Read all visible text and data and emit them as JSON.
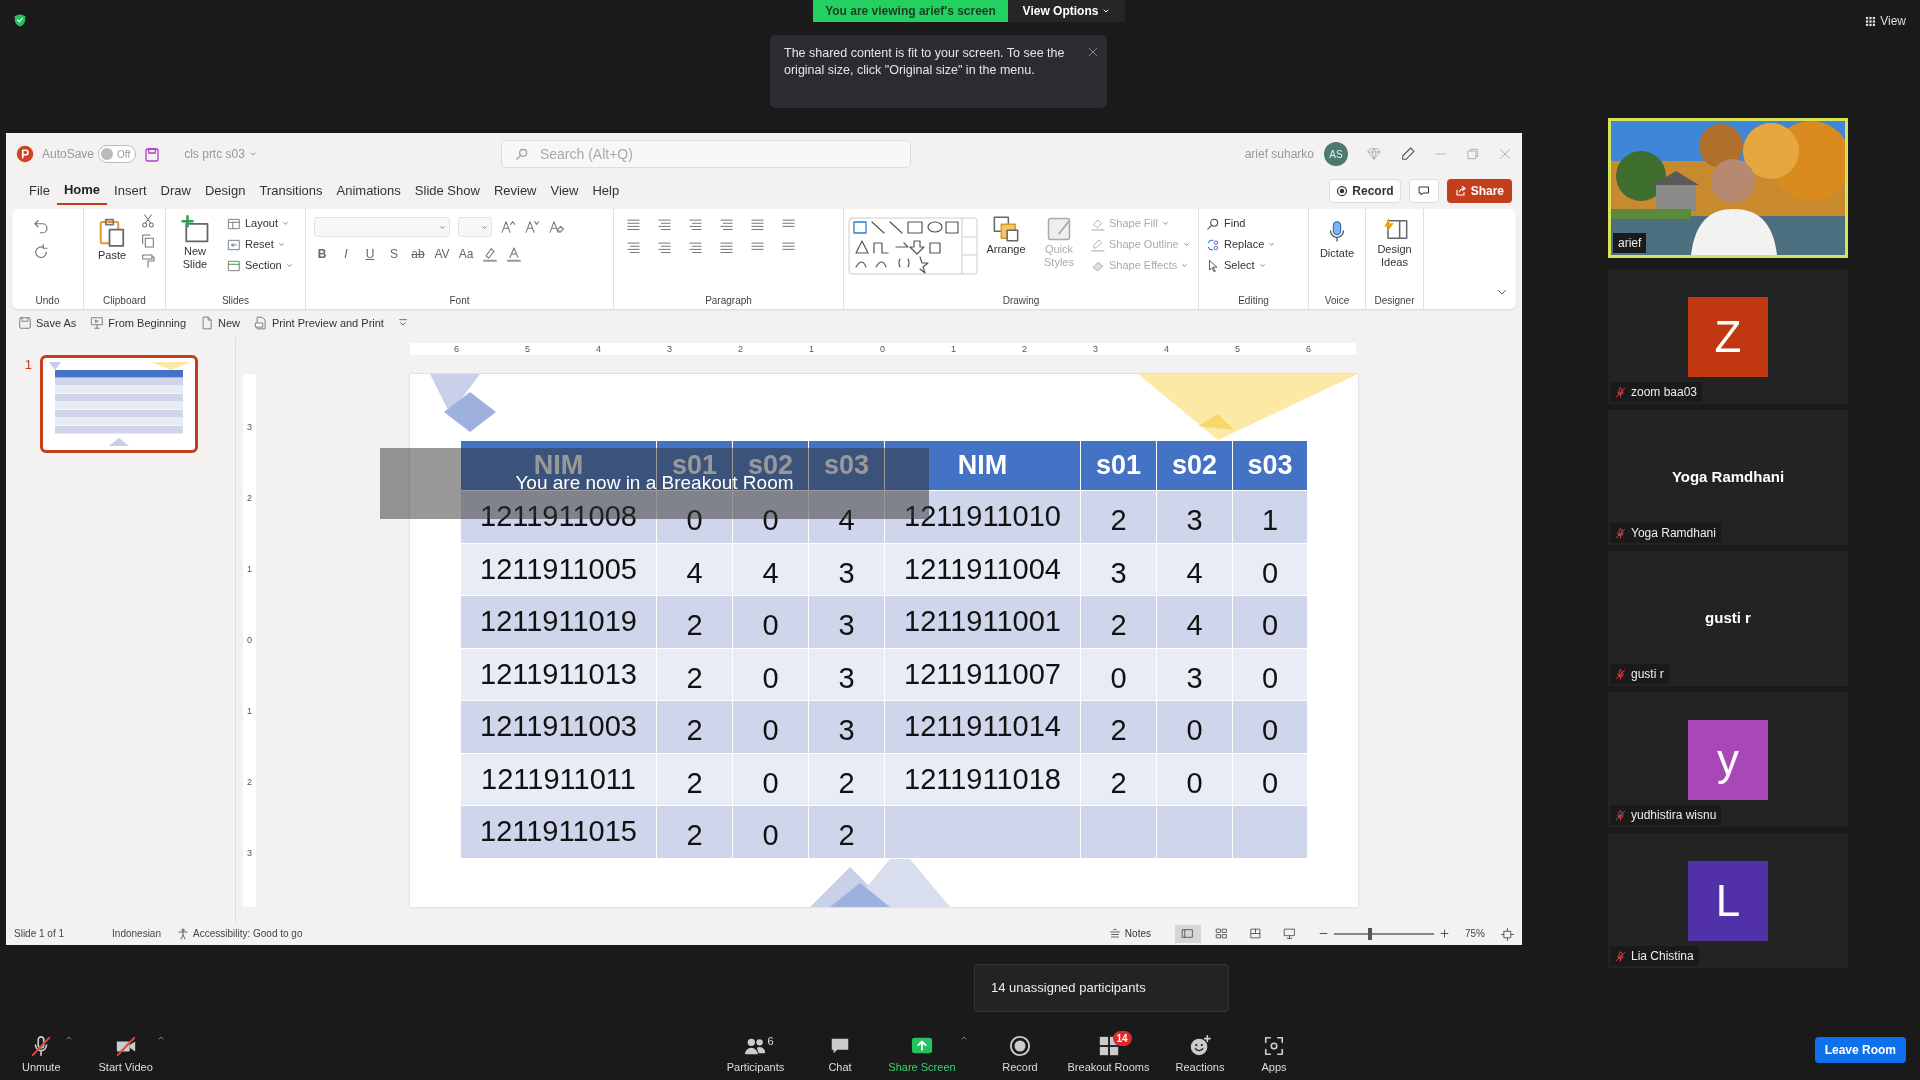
{
  "zoom_top": {
    "share_banner": "You are viewing arief's screen",
    "view_options": "View Options",
    "notice": "The shared content is fit to your screen. To see the original size, click \"Original size\" in the menu.",
    "view": "View"
  },
  "powerpoint": {
    "autosave": {
      "label": "AutoSave",
      "on": false,
      "state_text": "Off"
    },
    "file_name": "cls prtc s03",
    "search": {
      "placeholder": "Search (Alt+Q)"
    },
    "user": {
      "name": "arief suharko",
      "initials": "AS"
    },
    "menu_tabs": [
      {
        "label": "File",
        "selected": false
      },
      {
        "label": "Home",
        "selected": true
      },
      {
        "label": "Insert",
        "selected": false
      },
      {
        "label": "Draw",
        "selected": false
      },
      {
        "label": "Design",
        "selected": false
      },
      {
        "label": "Transitions",
        "selected": false
      },
      {
        "label": "Animations",
        "selected": false
      },
      {
        "label": "Slide Show",
        "selected": false
      },
      {
        "label": "Review",
        "selected": false
      },
      {
        "label": "View",
        "selected": false
      },
      {
        "label": "Help",
        "selected": false
      }
    ],
    "record": "Record",
    "share": "Share",
    "ribbon_groups": [
      {
        "kind": "undo",
        "label": "Undo"
      },
      {
        "kind": "clipboard",
        "label": "Clipboard",
        "items": [
          {
            "label": "Paste"
          }
        ]
      },
      {
        "kind": "slides",
        "label": "Slides",
        "items": [
          {
            "label": "New Slide"
          },
          {
            "label": "Layout"
          },
          {
            "label": "Reset"
          },
          {
            "label": "Section"
          }
        ]
      },
      {
        "kind": "font",
        "label": "Font",
        "glyphs": [
          "B",
          "I",
          "U",
          "S",
          "ab",
          "AV",
          "Aa"
        ]
      },
      {
        "kind": "paragraph",
        "label": "Paragraph"
      },
      {
        "kind": "drawing",
        "label": "Drawing",
        "items": [
          {
            "label": "Arrange",
            "disabled": false
          },
          {
            "label": "Quick Styles",
            "disabled": true
          },
          {
            "label": "Shape Fill",
            "disabled": true
          },
          {
            "label": "Shape Outline",
            "disabled": true
          },
          {
            "label": "Shape Effects",
            "disabled": true
          }
        ]
      },
      {
        "kind": "editing",
        "label": "Editing",
        "items": [
          {
            "label": "Find"
          },
          {
            "label": "Replace"
          },
          {
            "label": "Select"
          }
        ]
      },
      {
        "kind": "voice",
        "label": "Voice",
        "items": [
          {
            "label": "Dictate"
          }
        ]
      },
      {
        "kind": "designer",
        "label": "Designer",
        "items": [
          {
            "label": "Design Ideas"
          }
        ]
      }
    ],
    "quick_access": [
      {
        "kind": "save",
        "label": "Save As"
      },
      {
        "kind": "present",
        "label": "From Beginning"
      },
      {
        "kind": "new",
        "label": "New"
      },
      {
        "kind": "print",
        "label": "Print Preview and Print"
      }
    ],
    "slides_panel": [
      {
        "number": "1",
        "selected": true
      }
    ],
    "ruler": {
      "horizontal": [
        "6",
        "5",
        "4",
        "3",
        "2",
        "1",
        "0",
        "1",
        "2",
        "3",
        "4",
        "5",
        "6"
      ],
      "vertical": [
        "3",
        "2",
        "1",
        "0",
        "1",
        "2",
        "3"
      ]
    },
    "table": {
      "columns": [
        "NIM",
        "s01",
        "s02",
        "s03",
        "NIM",
        "s01",
        "s02",
        "s03"
      ],
      "rows": [
        [
          "1211911008",
          "0",
          "0",
          "4",
          "1211911010",
          "2",
          "3",
          "1"
        ],
        [
          "1211911005",
          "4",
          "4",
          "3",
          "1211911004",
          "3",
          "4",
          "0"
        ],
        [
          "1211911019",
          "2",
          "0",
          "3",
          "1211911001",
          "2",
          "4",
          "0"
        ],
        [
          "1211911013",
          "2",
          "0",
          "3",
          "1211911007",
          "0",
          "3",
          "0"
        ],
        [
          "1211911003",
          "2",
          "0",
          "3",
          "1211911014",
          "2",
          "0",
          "0"
        ],
        [
          "1211911011",
          "2",
          "0",
          "2",
          "1211911018",
          "2",
          "0",
          "0"
        ],
        [
          "1211911015",
          "2",
          "0",
          "2"
        ]
      ]
    },
    "status_bar": {
      "slide_info": "Slide 1 of 1",
      "language": "Indonesian",
      "accessibility": "Accessibility: Good to go",
      "notes": "Notes",
      "views": [
        {
          "selected": true
        },
        {
          "selected": false
        },
        {
          "selected": false
        },
        {
          "selected": false
        }
      ],
      "zoom": {
        "level": 0.36
      },
      "zoom_value": "75%"
    }
  },
  "breakout_toast": "You are now in a Breakout Room",
  "gallery": [
    {
      "kind": "video",
      "name": "arief",
      "speaking": true,
      "muted": false
    },
    {
      "kind": "avatar",
      "initial": "Z",
      "color": "#c1370f",
      "name": "zoom baa03",
      "speaking": false,
      "muted": true
    },
    {
      "kind": "name",
      "display": "Yoga Ramdhani",
      "name": "Yoga Ramdhani",
      "speaking": false,
      "muted": true
    },
    {
      "kind": "name",
      "display": "gusti r",
      "name": "gusti r",
      "speaking": false,
      "muted": true
    },
    {
      "kind": "avatar",
      "initial": "y",
      "color": "#a847b8",
      "name": "yudhistira wisnu",
      "speaking": false,
      "muted": true
    },
    {
      "kind": "avatar",
      "initial": "L",
      "color": "#5230a8",
      "name": "Lia Chistina",
      "speaking": false,
      "muted": true
    }
  ],
  "toolbar": {
    "audio": {
      "label": "Unmute",
      "muted": true
    },
    "video": {
      "label": "Start Video",
      "on": false
    },
    "items": [
      {
        "kind": "participants",
        "label": "Participants",
        "count": "6"
      },
      {
        "kind": "chat",
        "label": "Chat"
      },
      {
        "kind": "share",
        "label": "Share Screen"
      },
      {
        "kind": "record",
        "label": "Record"
      },
      {
        "kind": "breakout",
        "label": "Breakout Rooms",
        "badge": "14"
      },
      {
        "kind": "reactions",
        "label": "Reactions"
      },
      {
        "kind": "apps",
        "label": "Apps"
      }
    ],
    "tooltip": "14 unassigned participants",
    "leave": "Leave Room"
  }
}
